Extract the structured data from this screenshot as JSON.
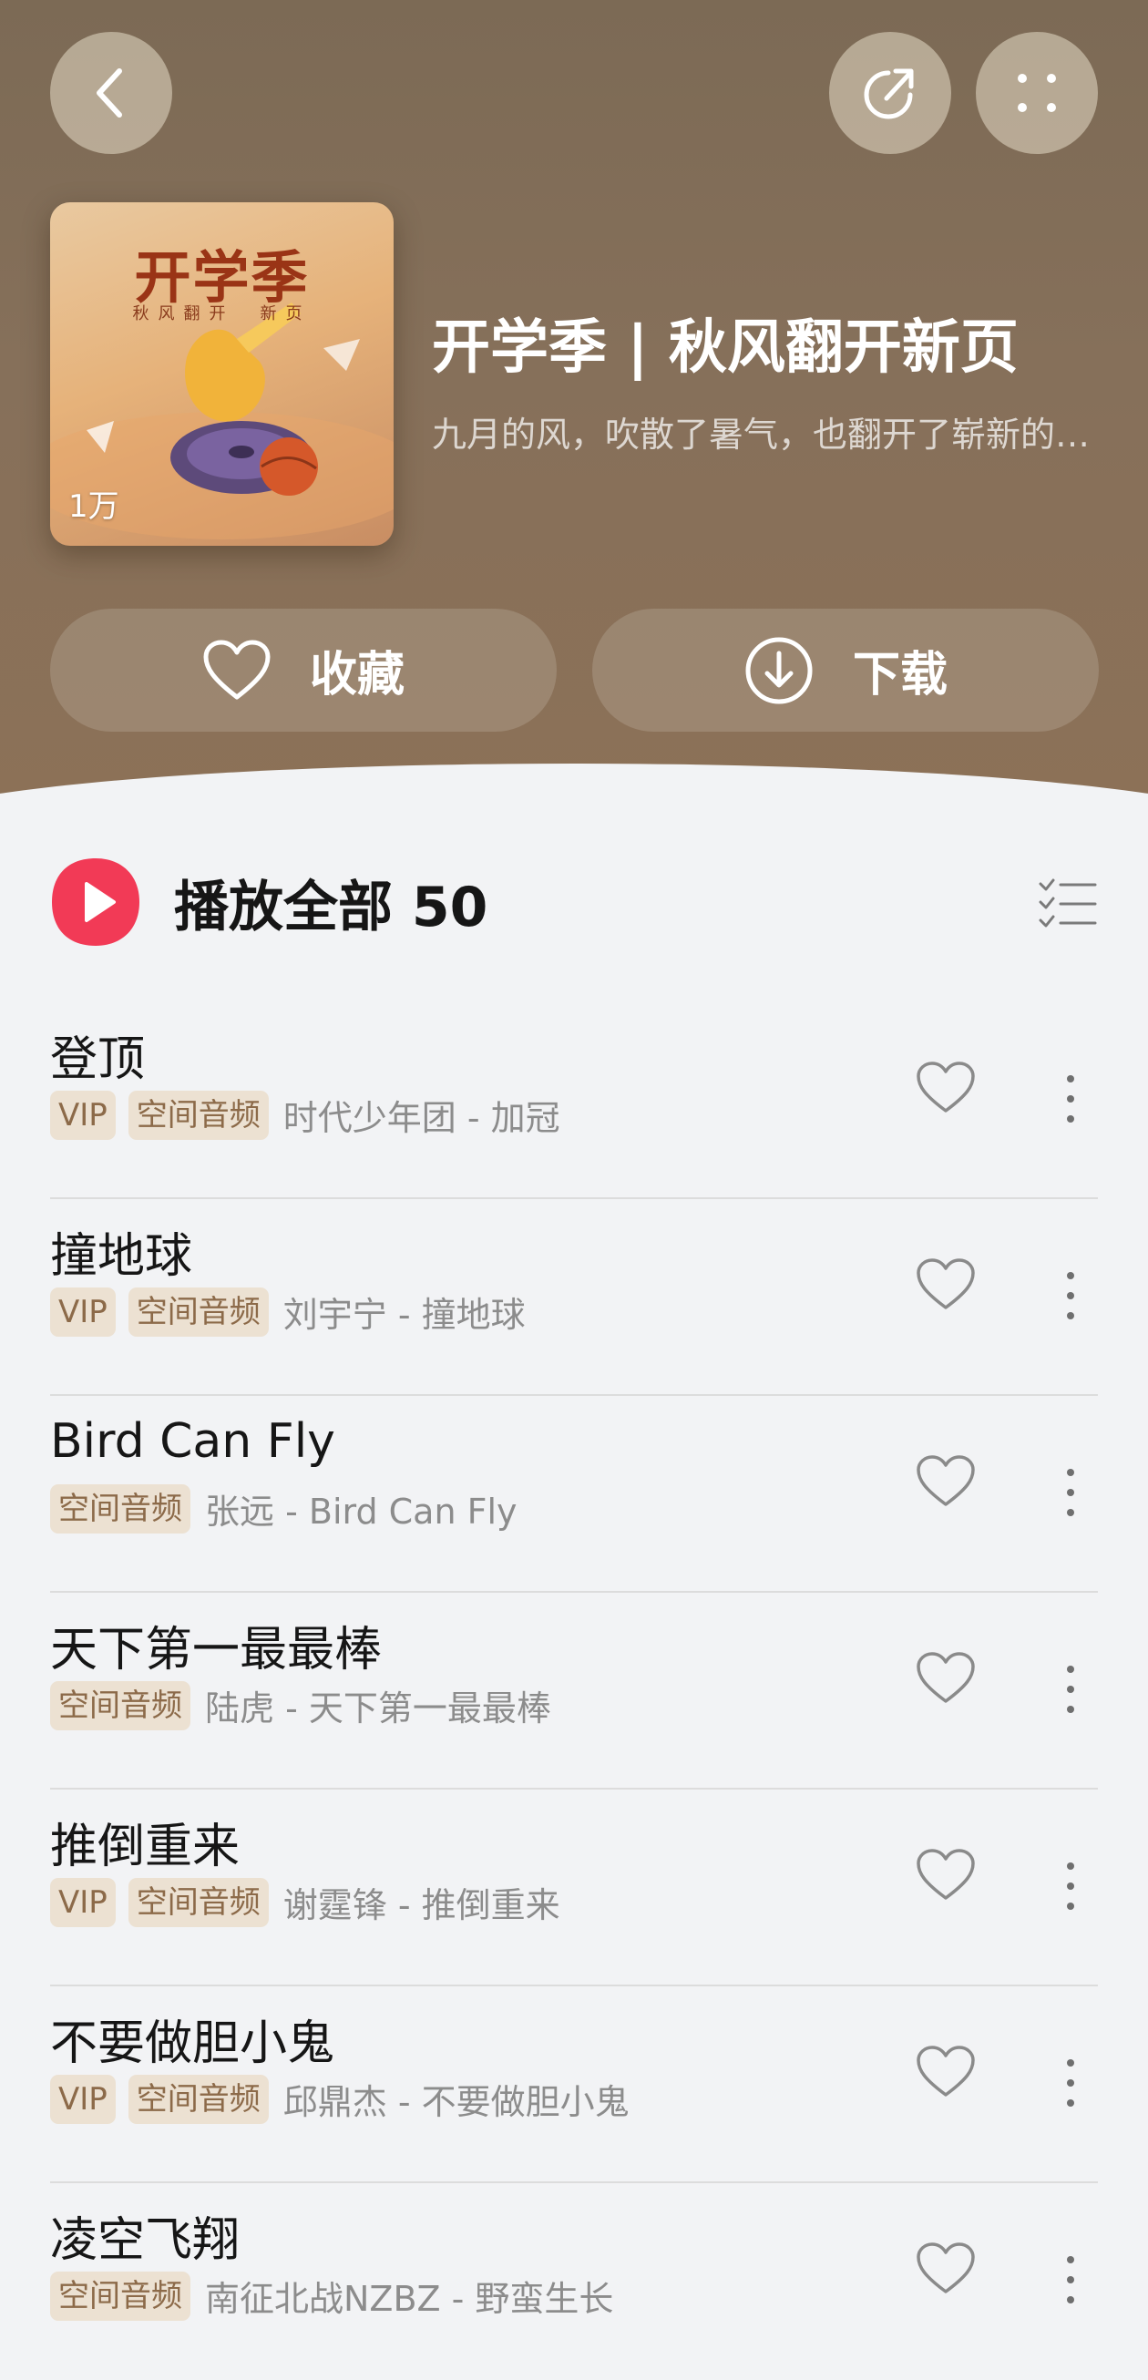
{
  "header": {
    "icons": {
      "back": "chevron-left-icon",
      "share": "share-icon",
      "more": "more-grid-icon"
    },
    "cover": {
      "title": "开学季",
      "subtitle": "秋风翻开　新页",
      "play_count": "1万"
    },
    "title": "开学季 | 秋风翻开新页",
    "description": "九月的风，吹散了暑气，也翻开了崭新的一页",
    "actions": {
      "favorite_label": "收藏",
      "download_label": "下载"
    }
  },
  "play_all": {
    "label": "播放全部 50",
    "accent_color": "#f23a56"
  },
  "songs": [
    {
      "title": "登顶",
      "tags": [
        "VIP",
        "空间音频"
      ],
      "artist": "时代少年团 - 加冠"
    },
    {
      "title": "撞地球",
      "tags": [
        "VIP",
        "空间音频"
      ],
      "artist": "刘宇宁 - 撞地球"
    },
    {
      "title": "Bird Can Fly",
      "tags": [
        "空间音频"
      ],
      "artist": "张远 - Bird Can Fly"
    },
    {
      "title": "天下第一最最棒",
      "tags": [
        "空间音频"
      ],
      "artist": "陆虎 - 天下第一最最棒"
    },
    {
      "title": "推倒重来",
      "tags": [
        "VIP",
        "空间音频"
      ],
      "artist": "谢霆锋 - 推倒重来"
    },
    {
      "title": "不要做胆小鬼",
      "tags": [
        "VIP",
        "空间音频"
      ],
      "artist": "邱鼎杰 - 不要做胆小鬼"
    },
    {
      "title": "凌空飞翔",
      "tags": [
        "空间音频"
      ],
      "artist": "南征北战NZBZ - 野蛮生长"
    }
  ],
  "colors": {
    "header_brown": "#86705a",
    "tag_bg": "#ece1d2",
    "tag_text": "#8c6a49"
  }
}
